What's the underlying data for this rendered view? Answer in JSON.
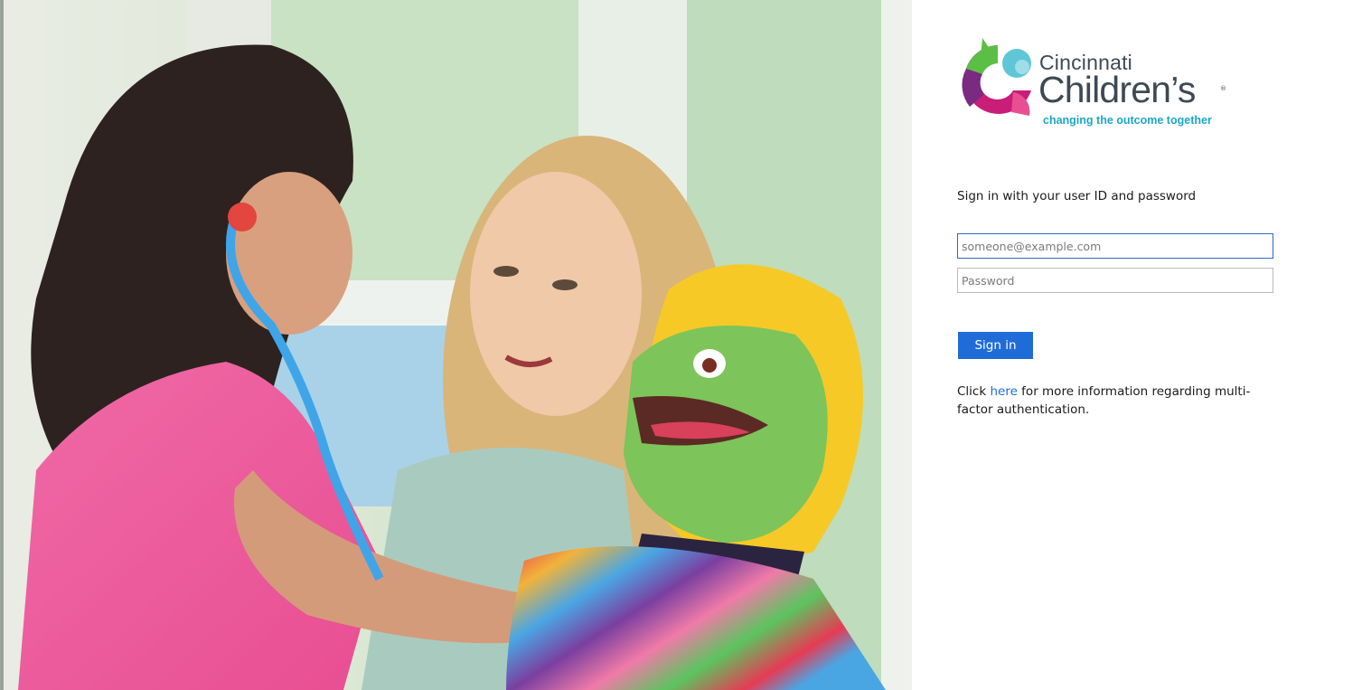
{
  "brand": {
    "name_line1": "Cincinnati",
    "name_line2": "Children’s",
    "registered": "®",
    "tagline": "changing the outcome together",
    "colors": {
      "text": "#3d4a55",
      "tagline": "#1ba7c5",
      "green": "#5bbf45",
      "teal": "#5fc6d6",
      "magenta": "#c81e7a",
      "purple": "#7a2a80"
    }
  },
  "hero": {
    "icon": "photo-child-doctor-puppet"
  },
  "signin": {
    "intro": "Sign in with your user ID and password",
    "email_placeholder": "someone@example.com",
    "password_placeholder": "Password",
    "button_label": "Sign in",
    "button_color": "#1f6cd8",
    "info_prefix": "Click ",
    "info_link": "here",
    "info_suffix": " for more information regarding multi-factor authentication."
  }
}
